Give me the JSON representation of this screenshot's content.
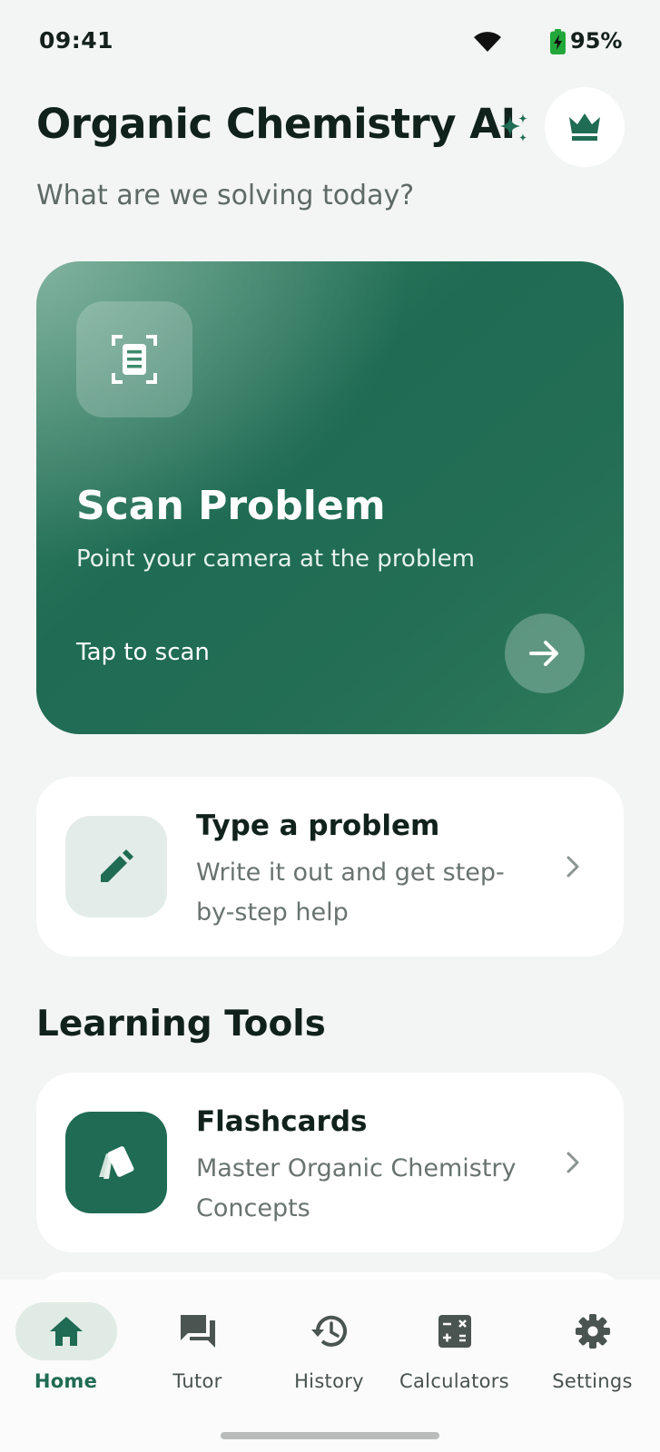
{
  "status_bar": {
    "time": "09:41",
    "battery": "95%",
    "icons": [
      "wifi-icon",
      "battery-charging-icon"
    ]
  },
  "header": {
    "title": "Organic Chemistry AI",
    "subtitle": "What are we solving today?",
    "icons": [
      "sparkle-icon",
      "crown-icon"
    ]
  },
  "scan_card": {
    "title": "Scan Problem",
    "description": "Point your camera at the problem",
    "cta": "Tap to scan",
    "icons": [
      "document-scan-icon",
      "arrow-right-icon"
    ]
  },
  "type_card": {
    "title": "Type a problem",
    "description": "Write it out and get step-by-step help",
    "icon": "pencil-icon"
  },
  "learning_tools": {
    "title": "Learning Tools",
    "items": [
      {
        "title": "Flashcards",
        "description": "Master Organic Chemistry Concepts",
        "icon": "flashcards-icon"
      }
    ]
  },
  "bottom_nav": {
    "items": [
      {
        "label": "Home",
        "icon": "home-icon",
        "active": true
      },
      {
        "label": "Tutor",
        "icon": "chat-icon",
        "active": false
      },
      {
        "label": "History",
        "icon": "history-icon",
        "active": false
      },
      {
        "label": "Calculators",
        "icon": "calculator-icon",
        "active": false
      },
      {
        "label": "Settings",
        "icon": "gear-icon",
        "active": false
      }
    ]
  },
  "colors": {
    "primary": "#1f6b53",
    "background": "#f3f5f4",
    "card": "#ffffff",
    "active_pill": "#e1ebe6"
  }
}
